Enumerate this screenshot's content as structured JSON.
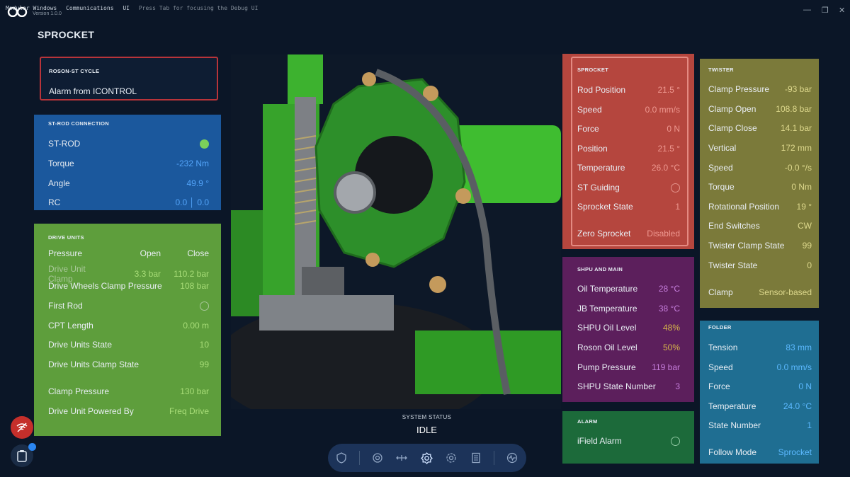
{
  "menu": {
    "items": [
      "Modular Windows",
      "Communications",
      "UI"
    ],
    "hint": "Press Tab for focusing the Debug UI",
    "version": "Version 1.0.0"
  },
  "page_title": "SPROCKET",
  "cycle": {
    "title": "ROSON-ST CYCLE",
    "message": "Alarm from ICONTROL"
  },
  "st_rod": {
    "title": "ST-ROD CONNECTION",
    "rows": [
      {
        "label": "ST-ROD",
        "value": ""
      },
      {
        "label": "Torque",
        "value": "-232 Nm"
      },
      {
        "label": "Angle",
        "value": "49.9 °"
      },
      {
        "label": "RC",
        "value": "0.0 │ 0.0"
      }
    ]
  },
  "drive_units": {
    "title": "DRIVE UNITS",
    "header": {
      "label": "Pressure",
      "col1": "Open",
      "col2": "Close"
    },
    "clamp_row": {
      "label": "Drive Unit Clamp",
      "col1": "3.3 bar",
      "col2": "110.2 bar"
    },
    "rows": [
      {
        "label": "Drive Wheels Clamp Pressure",
        "value": "108 bar"
      },
      {
        "label": "First Rod",
        "value": ""
      },
      {
        "label": "CPT Length",
        "value": "0.00 m"
      },
      {
        "label": "Drive Units State",
        "value": "10"
      },
      {
        "label": "Drive Units Clamp State",
        "value": "99"
      },
      {
        "label": "Clamp Pressure",
        "value": "130 bar"
      },
      {
        "label": "Drive Unit Powered By",
        "value": "Freq Drive"
      }
    ]
  },
  "sprocket": {
    "title": "SPROCKET",
    "rows": [
      {
        "label": "Rod Position",
        "value": "21.5 °"
      },
      {
        "label": "Speed",
        "value": "0.0 mm/s"
      },
      {
        "label": "Force",
        "value": "0 N"
      },
      {
        "label": "Position",
        "value": "21.5 °"
      },
      {
        "label": "Temperature",
        "value": "26.0 °C"
      },
      {
        "label": "ST Guiding",
        "value": ""
      },
      {
        "label": "Sprocket State",
        "value": "1"
      },
      {
        "label": "Zero Sprocket",
        "value": "Disabled"
      }
    ]
  },
  "twister": {
    "title": "TWISTER",
    "rows": [
      {
        "label": "Clamp Pressure",
        "value": "-93 bar"
      },
      {
        "label": "Clamp Open",
        "value": "108.8 bar"
      },
      {
        "label": "Clamp Close",
        "value": "14.1 bar"
      },
      {
        "label": "Vertical",
        "value": "172 mm"
      },
      {
        "label": "Speed",
        "value": "-0.0 °/s"
      },
      {
        "label": "Torque",
        "value": "0 Nm"
      },
      {
        "label": "Rotational Position",
        "value": "19 °"
      },
      {
        "label": "End Switches",
        "value": "CW"
      },
      {
        "label": "Twister Clamp State",
        "value": "99"
      },
      {
        "label": "Twister State",
        "value": "0"
      },
      {
        "label": "Clamp",
        "value": "Sensor-based"
      }
    ]
  },
  "shpu": {
    "title": "SHPU AND MAIN",
    "rows": [
      {
        "label": "Oil Temperature",
        "value": "28 °C"
      },
      {
        "label": "JB Temperature",
        "value": "38 °C"
      },
      {
        "label": "SHPU Oil Level",
        "value": "48%"
      },
      {
        "label": "Roson Oil Level",
        "value": "50%"
      },
      {
        "label": "Pump Pressure",
        "value": "119 bar"
      },
      {
        "label": "SHPU State Number",
        "value": "3"
      }
    ]
  },
  "alarm": {
    "title": "ALARM",
    "row": {
      "label": "iField Alarm",
      "value": ""
    }
  },
  "folder": {
    "title": "FOLDER",
    "rows": [
      {
        "label": "Tension",
        "value": "83 mm"
      },
      {
        "label": "Speed",
        "value": "0.0 mm/s"
      },
      {
        "label": "Force",
        "value": "0 N"
      },
      {
        "label": "Temperature",
        "value": "24.0 °C"
      },
      {
        "label": "State Number",
        "value": "1"
      },
      {
        "label": "Follow Mode",
        "value": "Sprocket"
      }
    ]
  },
  "system_status": {
    "title": "SYSTEM STATUS",
    "value": "IDLE"
  },
  "toolbar": {
    "icons": [
      "shield-icon",
      "target-icon",
      "move-icon",
      "gear-active-icon",
      "cog-icon",
      "list-icon",
      "waveform-icon"
    ]
  },
  "colors": {
    "background": "#0b1627",
    "cycle_border": "#b8343a",
    "st_rod": "#1c5aa0",
    "drive_units": "#5e9e3c",
    "sprocket": "#b5463e",
    "twister": "#7b7a3a",
    "shpu": "#5c1f5c",
    "alarm": "#1c6a3a",
    "folder": "#1f6e92",
    "machine_green": "#35a82a"
  }
}
